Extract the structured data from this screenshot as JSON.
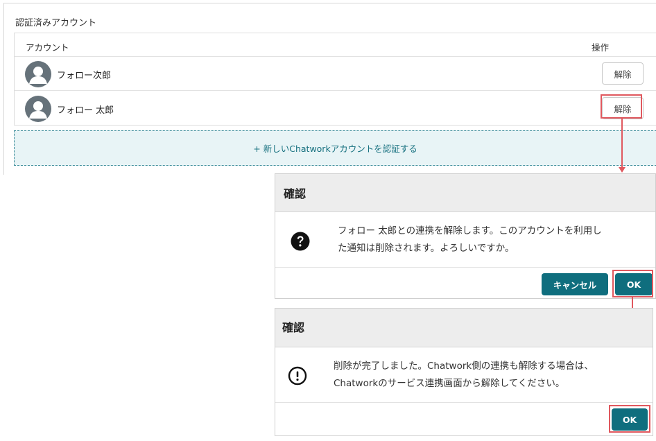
{
  "panel": {
    "title": "認証済みアカウント",
    "columns": {
      "account": "アカウント",
      "operation": "操作"
    },
    "accounts": [
      {
        "name": "フォロー次郎",
        "action": "解除"
      },
      {
        "name": "フォロー 太郎",
        "action": "解除"
      }
    ],
    "add_link": "+ 新しいChatworkアカウントを認証する"
  },
  "confirm_dialog": {
    "title": "確認",
    "message_line1": "フォロー 太郎との連携を解除します。このアカウントを利用し",
    "message_line2": "た通知は削除されます。よろしいですか。",
    "icon": "question-circle-icon",
    "cancel_label": "キャンセル",
    "ok_label": "OK"
  },
  "done_dialog": {
    "title": "確認",
    "message_line1": "削除が完了しました。Chatwork側の連携も解除する場合は、",
    "message_line2": "Chatworkのサービス連携画面から解除してください。",
    "icon": "exclamation-circle-icon",
    "ok_label": "OK"
  },
  "colors": {
    "accent": "#0f6e7e",
    "highlight": "#e0585e",
    "add_bg": "#e8f4f6",
    "avatar": "#66727a"
  }
}
